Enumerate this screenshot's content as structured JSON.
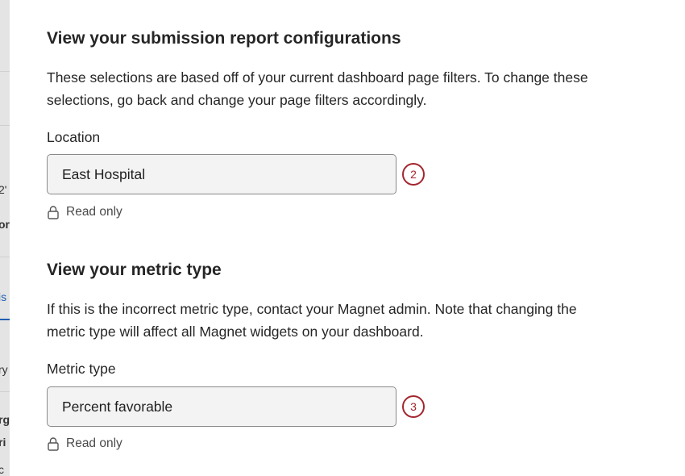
{
  "backdrop": {
    "fragments": [
      {
        "text": "2'",
        "style": "plain"
      },
      {
        "text": "or",
        "style": "bold"
      },
      {
        "text": "is",
        "style": "link"
      },
      {
        "text": "ry",
        "style": "plain"
      },
      {
        "text": "rg",
        "style": "bold"
      },
      {
        "text": "ri",
        "style": "bold"
      },
      {
        "text": "c",
        "style": "plain"
      }
    ]
  },
  "sections": [
    {
      "title": "View your submission report configurations",
      "description": "These selections are based off of your current dashboard page filters. To change these selections, go back and change your page filters accordingly.",
      "field_label": "Location",
      "field_value": "East Hospital",
      "callout": "2",
      "readonly_text": "Read only"
    },
    {
      "title": "View your metric type",
      "description": "If this is the incorrect metric type, contact your Magnet admin. Note that changing the metric type will affect all Magnet widgets on your dashboard.",
      "field_label": "Metric type",
      "field_value": "Percent favorable",
      "callout": "3",
      "readonly_text": "Read only"
    }
  ],
  "colors": {
    "callout": "#a3262f",
    "field_background": "#f3f3f3",
    "field_border": "#8a8a8a"
  },
  "icons": {
    "readonly": "lock-icon"
  }
}
